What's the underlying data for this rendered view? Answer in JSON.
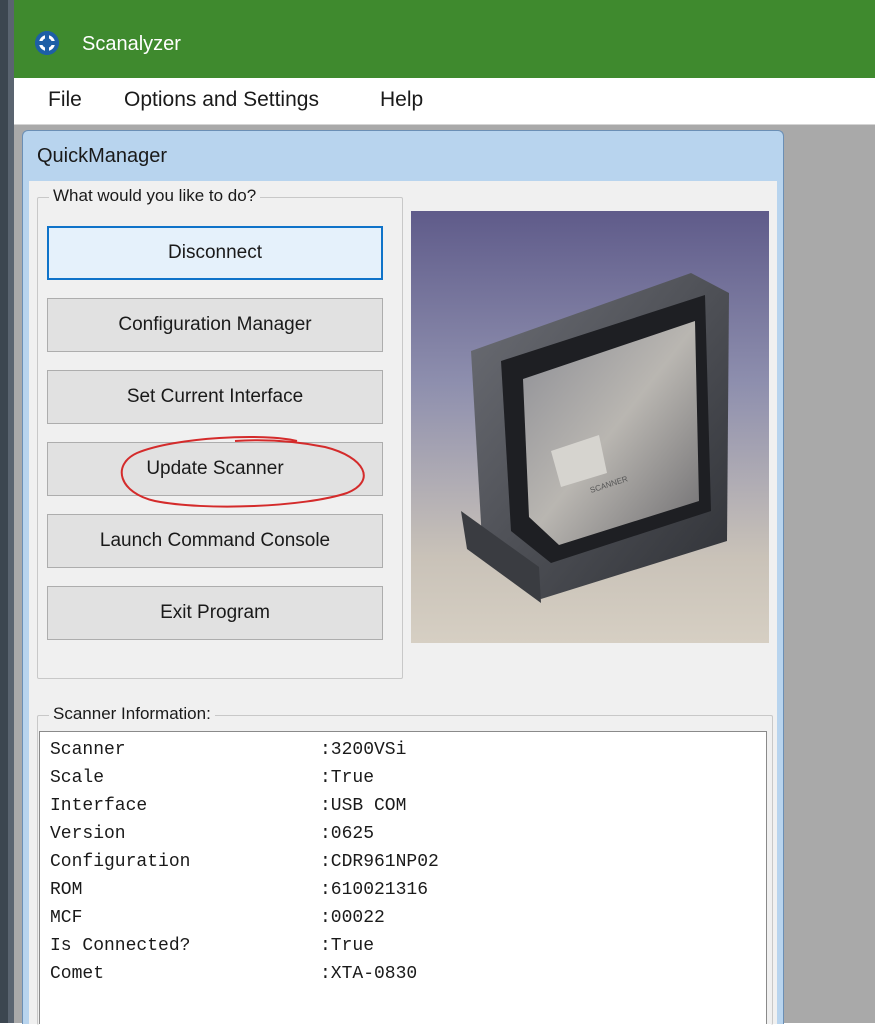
{
  "app": {
    "title": "Scanalyzer",
    "title_color": "#3f8a2e"
  },
  "menu": [
    "File",
    "Options and Settings",
    "Help"
  ],
  "quickmanager": {
    "title": "QuickManager",
    "group_label": "What would you like to do?",
    "buttons": [
      "Disconnect",
      "Configuration Manager",
      "Set Current Interface",
      "Update Scanner",
      "Launch Command Console",
      "Exit Program"
    ],
    "focused_button": "Disconnect",
    "annotated_button": "Update Scanner",
    "annotation_color": "#d42b2b",
    "scanner_image_label": "Scanner product photo",
    "info_label": "Scanner Information:",
    "info_rows": [
      {
        "key": "Scanner",
        "value": ":3200VSi"
      },
      {
        "key": "Scale",
        "value": ":True"
      },
      {
        "key": "Interface",
        "value": ":USB COM"
      },
      {
        "key": "Version",
        "value": ":0625"
      },
      {
        "key": "Configuration",
        "value": ":CDR961NP02"
      },
      {
        "key": "ROM",
        "value": ":610021316"
      },
      {
        "key": "MCF",
        "value": ":00022"
      },
      {
        "key": "Is Connected?",
        "value": ":True"
      },
      {
        "key": "Comet",
        "value": ":XTA-0830"
      }
    ]
  }
}
